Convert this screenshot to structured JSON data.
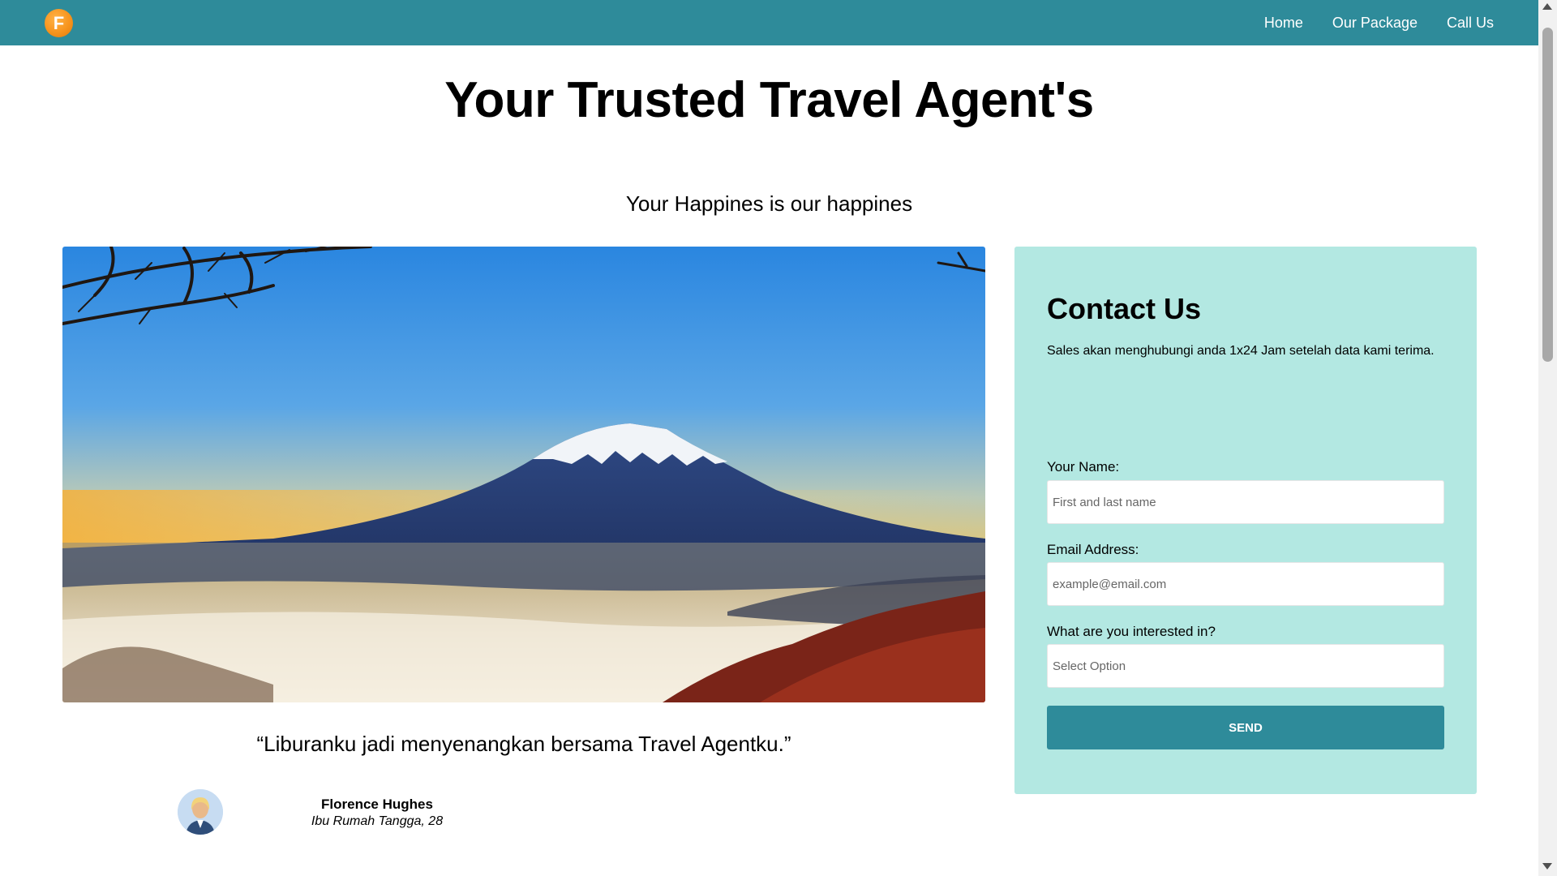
{
  "navbar": {
    "logo_letter": "F",
    "links": [
      "Home",
      "Our Package",
      "Call Us"
    ],
    "background": "#2e8b9a"
  },
  "hero": {
    "title": "Your Trusted Travel Agent's",
    "subtitle": "Your Happines is our happines",
    "image_subject": "Mount Fuji above a sea of clouds at sunrise"
  },
  "testimonial": {
    "quote": "“Liburanku jadi menyenangkan bersama Travel Agentku.”",
    "name": "Florence Hughes",
    "role": "Ibu Rumah Tangga, 28"
  },
  "contact": {
    "title": "Contact Us",
    "description": "Sales akan menghubungi anda 1x24 Jam setelah data kami terima.",
    "name_label": "Your Name:",
    "name_placeholder": "First and last name",
    "email_label": "Email Address:",
    "email_placeholder": "example@email.com",
    "interest_label": "What are you interested in?",
    "interest_value": "Select Option",
    "send_label": "SEND",
    "card_background": "#b3e8e2"
  }
}
